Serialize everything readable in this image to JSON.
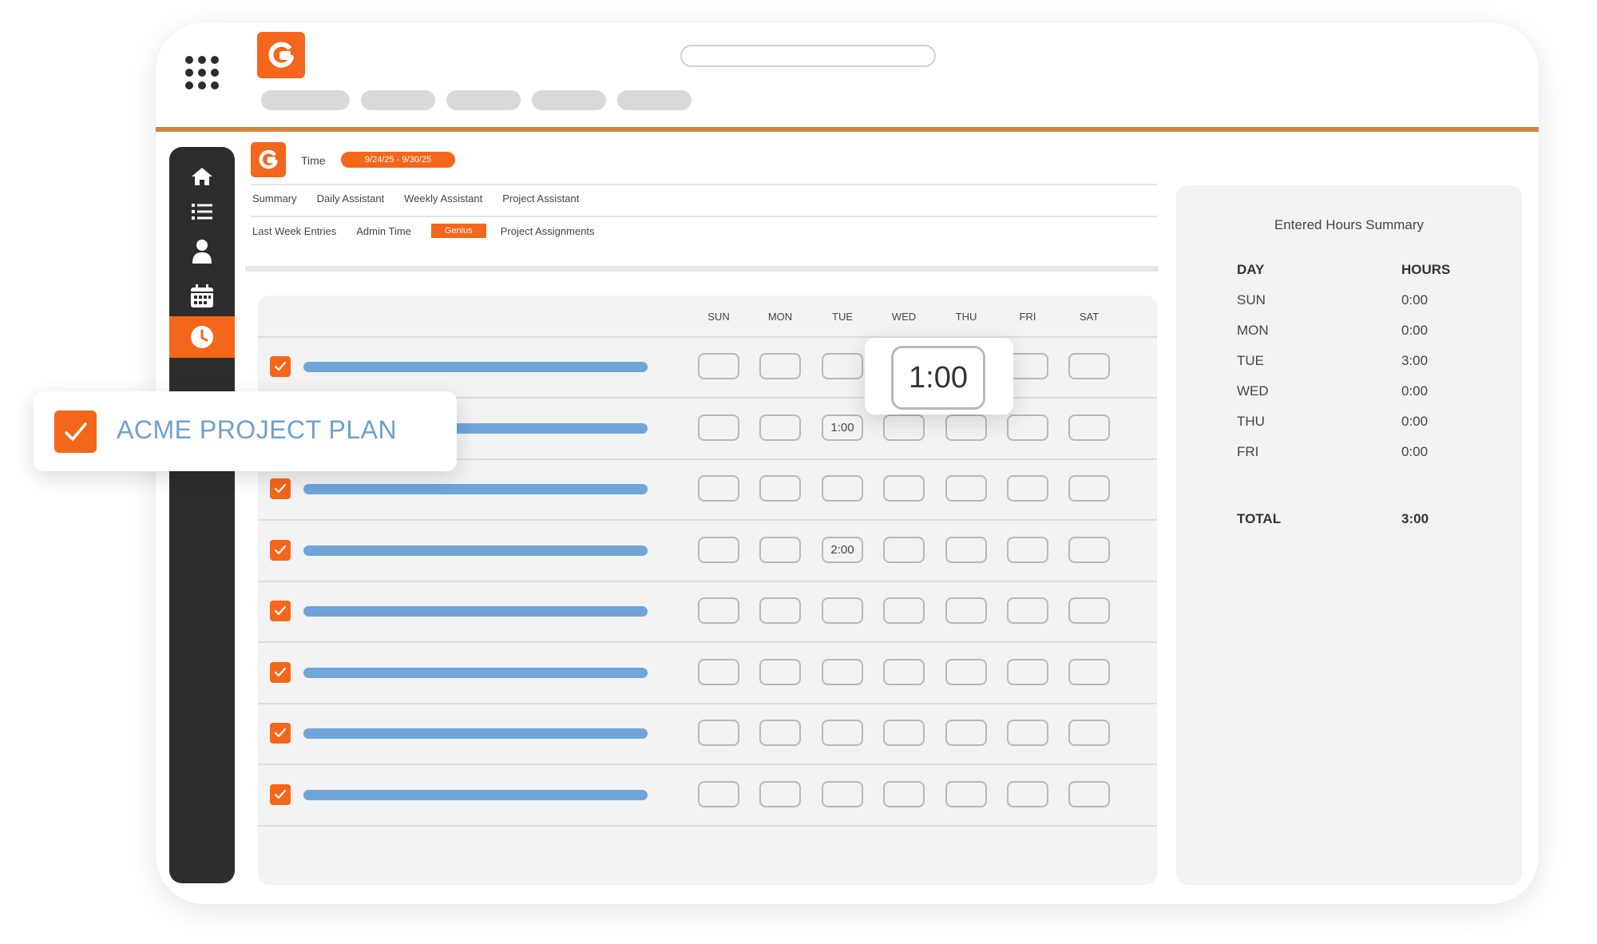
{
  "header": {
    "nav_pills": [
      {
        "w": 111
      },
      {
        "w": 93
      },
      {
        "w": 93
      },
      {
        "w": 93
      },
      {
        "w": 93
      }
    ]
  },
  "module": {
    "title": "Time",
    "date_range": "9/24/25 - 9/30/25",
    "tabs_row1": [
      "Summary",
      "Daily Assistant",
      "Weekly Assistant",
      "Project Assistant"
    ],
    "tabs_row2": [
      "Last Week Entries",
      "Admin Time",
      "Genius",
      "Project Assignments"
    ],
    "active_tab": "Genius"
  },
  "timesheet": {
    "days": [
      "SUN",
      "MON",
      "TUE",
      "WED",
      "THU",
      "FRI",
      "SAT"
    ],
    "rows": [
      {
        "checked": true,
        "cells": [
          "",
          "",
          "",
          "",
          "",
          "",
          ""
        ]
      },
      {
        "checked": true,
        "cells": [
          "",
          "",
          "1:00",
          "",
          "",
          "",
          ""
        ]
      },
      {
        "checked": true,
        "cells": [
          "",
          "",
          "",
          "",
          "",
          "",
          ""
        ]
      },
      {
        "checked": true,
        "cells": [
          "",
          "",
          "2:00",
          "",
          "",
          "",
          ""
        ]
      },
      {
        "checked": true,
        "cells": [
          "",
          "",
          "",
          "",
          "",
          "",
          ""
        ]
      },
      {
        "checked": true,
        "cells": [
          "",
          "",
          "",
          "",
          "",
          "",
          ""
        ]
      },
      {
        "checked": true,
        "cells": [
          "",
          "",
          "",
          "",
          "",
          "",
          ""
        ]
      },
      {
        "checked": true,
        "cells": [
          "",
          "",
          "",
          "",
          "",
          "",
          ""
        ]
      }
    ]
  },
  "callout": {
    "label": "ACME PROJECT PLAN",
    "checked": true
  },
  "zoom": {
    "value": "1:00"
  },
  "summary": {
    "title": "Entered Hours Summary",
    "col_day": "DAY",
    "col_hours": "HOURS",
    "rows": [
      {
        "day": "SUN",
        "hours": "0:00"
      },
      {
        "day": "MON",
        "hours": "0:00"
      },
      {
        "day": "TUE",
        "hours": "3:00"
      },
      {
        "day": "WED",
        "hours": "0:00"
      },
      {
        "day": "THU",
        "hours": "0:00"
      },
      {
        "day": "FRI",
        "hours": "0:00"
      }
    ],
    "total_label": "TOTAL",
    "total_value": "3:00"
  },
  "colors": {
    "accent": "#f4661b",
    "bar": "#6fa5d8",
    "divider": "#d3843f",
    "sidebar": "#2d2d2d"
  },
  "sidebar": {
    "icons": [
      "home-icon",
      "list-icon",
      "user-icon",
      "calendar-icon",
      "clock-icon"
    ],
    "active": "clock-icon"
  }
}
